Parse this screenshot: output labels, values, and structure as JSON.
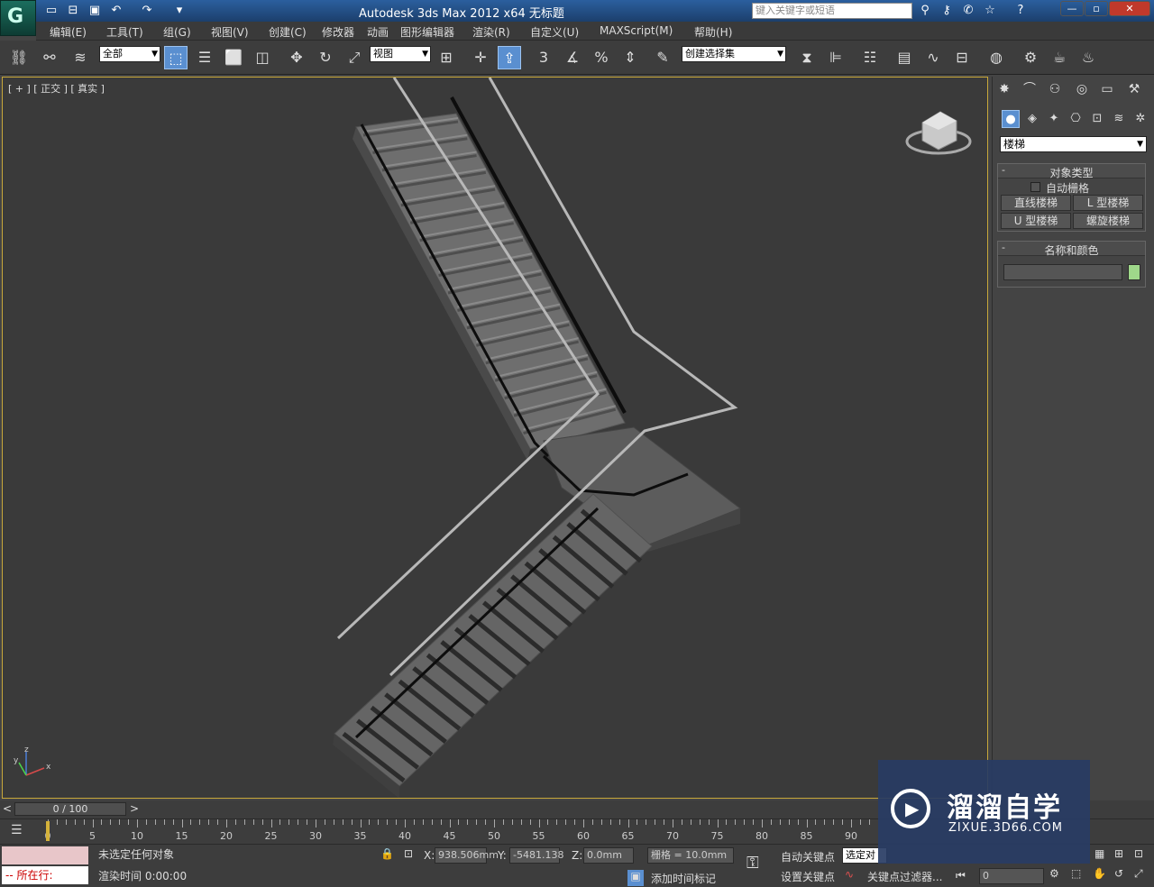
{
  "window": {
    "title": "Autodesk 3ds Max  2012 x64      无标题",
    "search_placeholder": "键入关键字或短语"
  },
  "menu": [
    "编辑(E)",
    "工具(T)",
    "组(G)",
    "视图(V)",
    "创建(C)",
    "修改器",
    "动画",
    "图形编辑器",
    "渲染(R)",
    "自定义(U)",
    "MAXScript(M)",
    "帮助(H)"
  ],
  "toolbar": {
    "selection_filter": "全部",
    "ref_coord": "视图",
    "named_selection": "创建选择集",
    "snap_3": "3",
    "snap_pct": "%"
  },
  "viewport": {
    "label": "[ + ] [ 正交 ] [ 真实 ]",
    "axis_z": "z",
    "axis_x": "x",
    "axis_y": "y"
  },
  "command_panel": {
    "category": "楼梯",
    "rollout_object_type": "对象类型",
    "autogrid": "自动栅格",
    "buttons": [
      "直线楼梯",
      "L 型楼梯",
      "U 型楼梯",
      "螺旋楼梯"
    ],
    "rollout_name_color": "名称和颜色",
    "name_value": "",
    "object_color": "#9fd88a"
  },
  "timeline": {
    "slider_label": "0 / 100",
    "ticks": [
      "0",
      "5",
      "10",
      "15",
      "20",
      "25",
      "30",
      "35",
      "40",
      "45",
      "50",
      "55",
      "60",
      "65",
      "70",
      "75",
      "80",
      "85",
      "90"
    ]
  },
  "status": {
    "maxscript_prompt": "-- 所在行:",
    "selection_text": "未选定任何对象",
    "render_time": "渲染时间  0:00:00",
    "x_label": "X:",
    "x_value": "938.506mm",
    "y_label": "Y:",
    "y_value": "-5481.138",
    "z_label": "Z:",
    "z_value": "0.0mm",
    "grid": "栅格 = 10.0mm",
    "add_time_tag": "添加时间标记",
    "auto_key": "自动关键点",
    "set_key": "设置关键点",
    "selected_dd": "选定对",
    "key_filters": "关键点过滤器...",
    "frame_value": "0"
  },
  "watermark": {
    "title": "溜溜自学",
    "url": "ZIXUE.3D66.COM"
  }
}
